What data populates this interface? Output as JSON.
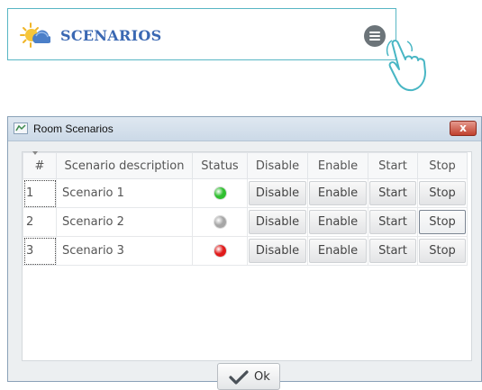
{
  "widget": {
    "title": "SCENARIOS",
    "icons": {
      "scene": "sun-cloud-icon",
      "menu": "menu-icon",
      "pointer": "hand-pointer-icon"
    },
    "colors": {
      "title": "#3a68b3",
      "border": "#58b6c4"
    }
  },
  "dialog": {
    "title": "Room Scenarios",
    "close_label": "x",
    "columns": [
      "#",
      "Scenario description",
      "Status",
      "Disable",
      "Enable",
      "Start",
      "Stop"
    ],
    "rows": [
      {
        "num": "1",
        "description": "Scenario 1",
        "status": "green",
        "disable": "Disable",
        "enable": "Enable",
        "start": "Start",
        "stop": "Stop"
      },
      {
        "num": "2",
        "description": "Scenario 2",
        "status": "grey",
        "disable": "Disable",
        "enable": "Enable",
        "start": "Start",
        "stop": "Stop"
      },
      {
        "num": "3",
        "description": "Scenario 3",
        "status": "red",
        "disable": "Disable",
        "enable": "Enable",
        "start": "Start",
        "stop": "Stop"
      }
    ],
    "status_colors": {
      "green": "#2fbf2f",
      "grey": "#a6a6a6",
      "red": "#e01b1b"
    },
    "ok_label": "Ok",
    "ok_icon": "checkmark-icon"
  }
}
